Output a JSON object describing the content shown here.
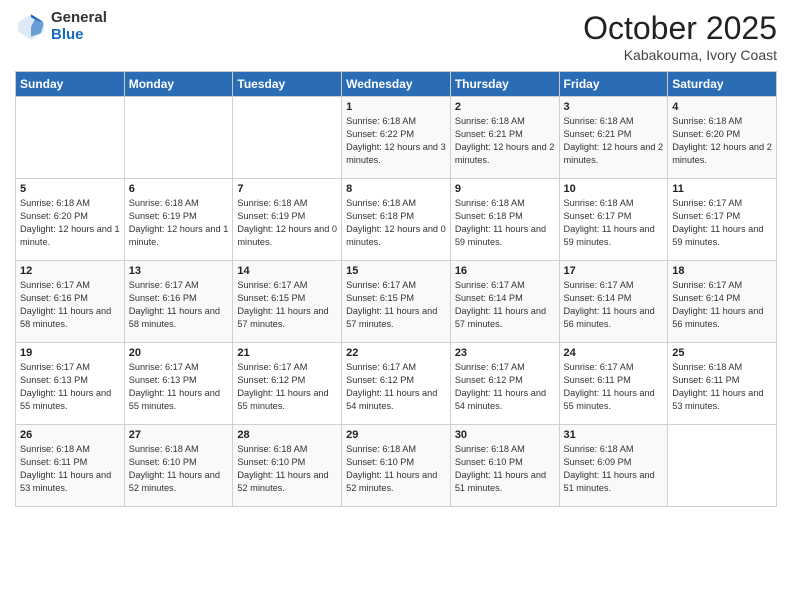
{
  "header": {
    "logo_general": "General",
    "logo_blue": "Blue",
    "month_title": "October 2025",
    "location": "Kabakouma, Ivory Coast"
  },
  "days_of_week": [
    "Sunday",
    "Monday",
    "Tuesday",
    "Wednesday",
    "Thursday",
    "Friday",
    "Saturday"
  ],
  "weeks": [
    [
      {
        "day": "",
        "info": ""
      },
      {
        "day": "",
        "info": ""
      },
      {
        "day": "",
        "info": ""
      },
      {
        "day": "1",
        "info": "Sunrise: 6:18 AM\nSunset: 6:22 PM\nDaylight: 12 hours and 3 minutes."
      },
      {
        "day": "2",
        "info": "Sunrise: 6:18 AM\nSunset: 6:21 PM\nDaylight: 12 hours and 2 minutes."
      },
      {
        "day": "3",
        "info": "Sunrise: 6:18 AM\nSunset: 6:21 PM\nDaylight: 12 hours and 2 minutes."
      },
      {
        "day": "4",
        "info": "Sunrise: 6:18 AM\nSunset: 6:20 PM\nDaylight: 12 hours and 2 minutes."
      }
    ],
    [
      {
        "day": "5",
        "info": "Sunrise: 6:18 AM\nSunset: 6:20 PM\nDaylight: 12 hours and 1 minute."
      },
      {
        "day": "6",
        "info": "Sunrise: 6:18 AM\nSunset: 6:19 PM\nDaylight: 12 hours and 1 minute."
      },
      {
        "day": "7",
        "info": "Sunrise: 6:18 AM\nSunset: 6:19 PM\nDaylight: 12 hours and 0 minutes."
      },
      {
        "day": "8",
        "info": "Sunrise: 6:18 AM\nSunset: 6:18 PM\nDaylight: 12 hours and 0 minutes."
      },
      {
        "day": "9",
        "info": "Sunrise: 6:18 AM\nSunset: 6:18 PM\nDaylight: 11 hours and 59 minutes."
      },
      {
        "day": "10",
        "info": "Sunrise: 6:18 AM\nSunset: 6:17 PM\nDaylight: 11 hours and 59 minutes."
      },
      {
        "day": "11",
        "info": "Sunrise: 6:17 AM\nSunset: 6:17 PM\nDaylight: 11 hours and 59 minutes."
      }
    ],
    [
      {
        "day": "12",
        "info": "Sunrise: 6:17 AM\nSunset: 6:16 PM\nDaylight: 11 hours and 58 minutes."
      },
      {
        "day": "13",
        "info": "Sunrise: 6:17 AM\nSunset: 6:16 PM\nDaylight: 11 hours and 58 minutes."
      },
      {
        "day": "14",
        "info": "Sunrise: 6:17 AM\nSunset: 6:15 PM\nDaylight: 11 hours and 57 minutes."
      },
      {
        "day": "15",
        "info": "Sunrise: 6:17 AM\nSunset: 6:15 PM\nDaylight: 11 hours and 57 minutes."
      },
      {
        "day": "16",
        "info": "Sunrise: 6:17 AM\nSunset: 6:14 PM\nDaylight: 11 hours and 57 minutes."
      },
      {
        "day": "17",
        "info": "Sunrise: 6:17 AM\nSunset: 6:14 PM\nDaylight: 11 hours and 56 minutes."
      },
      {
        "day": "18",
        "info": "Sunrise: 6:17 AM\nSunset: 6:14 PM\nDaylight: 11 hours and 56 minutes."
      }
    ],
    [
      {
        "day": "19",
        "info": "Sunrise: 6:17 AM\nSunset: 6:13 PM\nDaylight: 11 hours and 55 minutes."
      },
      {
        "day": "20",
        "info": "Sunrise: 6:17 AM\nSunset: 6:13 PM\nDaylight: 11 hours and 55 minutes."
      },
      {
        "day": "21",
        "info": "Sunrise: 6:17 AM\nSunset: 6:12 PM\nDaylight: 11 hours and 55 minutes."
      },
      {
        "day": "22",
        "info": "Sunrise: 6:17 AM\nSunset: 6:12 PM\nDaylight: 11 hours and 54 minutes."
      },
      {
        "day": "23",
        "info": "Sunrise: 6:17 AM\nSunset: 6:12 PM\nDaylight: 11 hours and 54 minutes."
      },
      {
        "day": "24",
        "info": "Sunrise: 6:17 AM\nSunset: 6:11 PM\nDaylight: 11 hours and 55 minutes."
      },
      {
        "day": "25",
        "info": "Sunrise: 6:18 AM\nSunset: 6:11 PM\nDaylight: 11 hours and 53 minutes."
      }
    ],
    [
      {
        "day": "26",
        "info": "Sunrise: 6:18 AM\nSunset: 6:11 PM\nDaylight: 11 hours and 53 minutes."
      },
      {
        "day": "27",
        "info": "Sunrise: 6:18 AM\nSunset: 6:10 PM\nDaylight: 11 hours and 52 minutes."
      },
      {
        "day": "28",
        "info": "Sunrise: 6:18 AM\nSunset: 6:10 PM\nDaylight: 11 hours and 52 minutes."
      },
      {
        "day": "29",
        "info": "Sunrise: 6:18 AM\nSunset: 6:10 PM\nDaylight: 11 hours and 52 minutes."
      },
      {
        "day": "30",
        "info": "Sunrise: 6:18 AM\nSunset: 6:10 PM\nDaylight: 11 hours and 51 minutes."
      },
      {
        "day": "31",
        "info": "Sunrise: 6:18 AM\nSunset: 6:09 PM\nDaylight: 11 hours and 51 minutes."
      },
      {
        "day": "",
        "info": ""
      }
    ]
  ]
}
